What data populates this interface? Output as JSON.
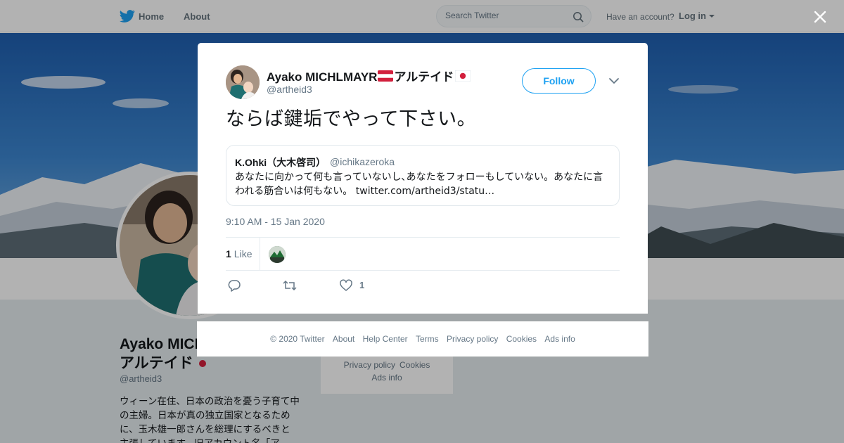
{
  "topbar": {
    "home_label": "Home",
    "about_label": "About",
    "search_placeholder": "Search Twitter",
    "have_account": "Have an account?",
    "login_label": "Log in"
  },
  "profile": {
    "name_line1": "Ayako MICHLMAYR",
    "name_line2": "アルテイド",
    "handle": "@artheid3",
    "bio": "ウィーン在住、日本の政治を憂う子育て中の主婦。日本が真の独立国家となるために、玉木雄一郎さんを総理にするべきと主張しています。旧アカウント名「ア"
  },
  "sidebar_links": [
    "Privacy policy",
    "Cookies",
    "Ads info"
  ],
  "tweet": {
    "author_name": "Ayako MICHLMAYR",
    "author_name_suffix": "アルテイド",
    "author_handle": "@artheid3",
    "follow_label": "Follow",
    "text": "ならば鍵垢でやって下さい。",
    "quote": {
      "name": "K.Ohki（大木啓司）",
      "handle": "@ichikazeroka",
      "text": "あなたに向かって何も言っていないし､あなたをフォローもしていない。あなたに言われる筋合いは何もない。",
      "link": "twitter.com/artheid3/statu…"
    },
    "timestamp": "9:10 AM - 15 Jan 2020",
    "like_count": "1",
    "like_word": "Like",
    "action_like_count": "1"
  },
  "footer": {
    "links": [
      "© 2020 Twitter",
      "About",
      "Help Center",
      "Terms",
      "Privacy policy",
      "Cookies",
      "Ads info"
    ]
  },
  "colors": {
    "accent": "#1da1f2",
    "secondary_text": "#657786",
    "flag_red": "#d21f3c"
  },
  "icons": [
    "twitter-bird-icon",
    "search-icon",
    "caret-down-icon",
    "close-icon",
    "chevron-down-icon",
    "reply-icon",
    "retweet-icon",
    "heart-icon",
    "austria-flag-icon",
    "japan-flag-icon"
  ]
}
